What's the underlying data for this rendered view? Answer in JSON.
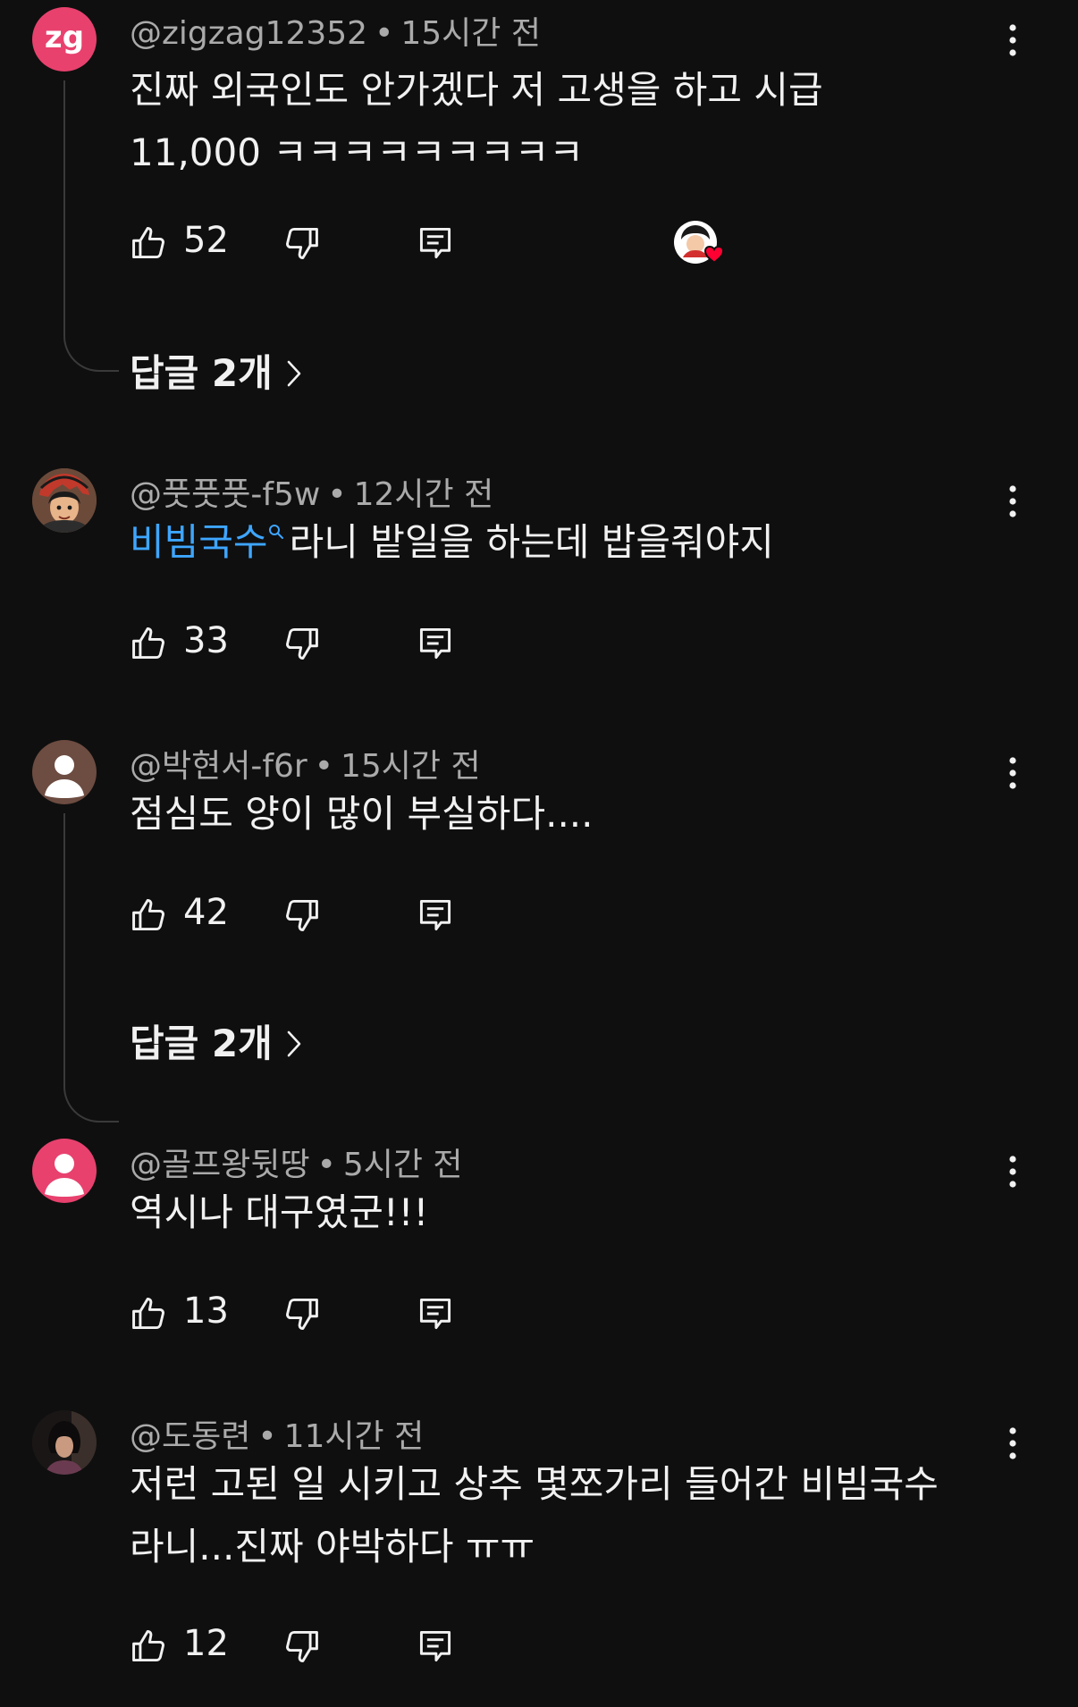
{
  "comments": [
    {
      "avatar_initials": "zg",
      "avatar_color": "#e8416e",
      "username": "@zigzag12352",
      "time": "15시간 전",
      "text": "진짜 외국인도 안가겠다 저 고생을 하고 시급\n11,000 ㅋㅋㅋㅋㅋㅋㅋㅋㅋ",
      "likes": "52",
      "creator_hearted": true,
      "replies": "답글 2개"
    },
    {
      "username": "@풋풋풋-f5w",
      "time": "12시간 전",
      "link_text": "비빔국수",
      "text": "라니 밭일을 하는데 밥을줘야지",
      "likes": "33"
    },
    {
      "avatar_color": "#6d4c41",
      "username": "@박현서-f6r",
      "time": "15시간 전",
      "text": "점심도 양이 많이 부실하다....",
      "likes": "42",
      "replies": "답글 2개"
    },
    {
      "avatar_color": "#e8416e",
      "username": "@골프왕뒷땅",
      "time": "5시간 전",
      "text": "역시나 대구였군!!!",
      "likes": "13"
    },
    {
      "username": "@도동련",
      "time": "11시간 전",
      "text": "저런 고된 일 시키고 상추 몇쪼가리 들어간 비빔국수\n라니...진짜 야박하다 ㅠㅠ",
      "likes": "12"
    }
  ],
  "icons": {
    "like": "thumbs-up-icon",
    "dislike": "thumbs-down-icon",
    "reply": "reply-comment-icon",
    "more": "more-vertical-icon",
    "chevron": "chevron-right-icon",
    "search": "search-mini-icon",
    "heart": "creator-heart-icon"
  },
  "colors": {
    "background": "#0f0f0f",
    "text": "#f1f1f1",
    "meta": "#aaaaaa",
    "link": "#3ea6ff",
    "heart": "#ff0033"
  }
}
